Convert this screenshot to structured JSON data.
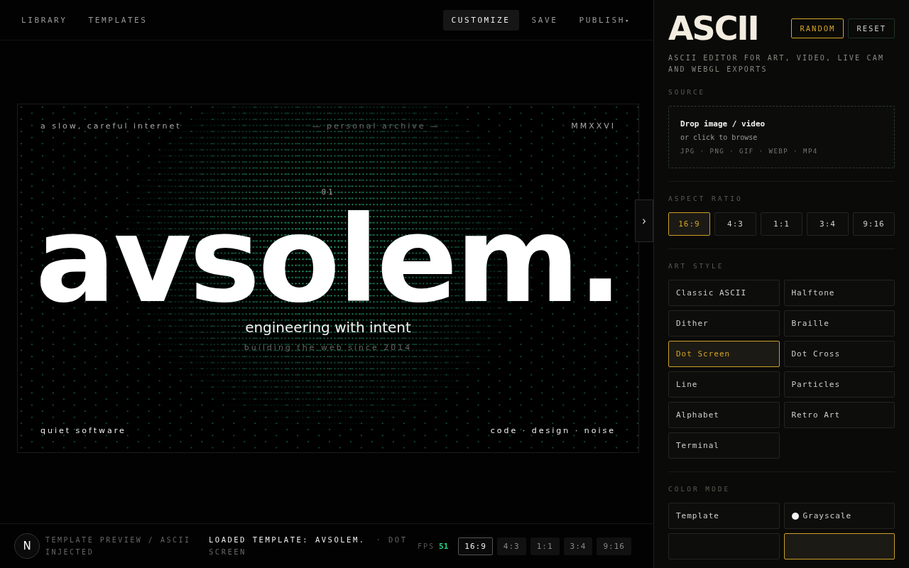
{
  "nav": {
    "left": [
      {
        "label": "LIBRARY",
        "selected": false
      },
      {
        "label": "TEMPLATES",
        "selected": false
      }
    ],
    "right": [
      {
        "label": "CUSTOMIZE",
        "selected": true,
        "kind": "tab"
      },
      {
        "label": "SAVE",
        "selected": false,
        "kind": "tab"
      },
      {
        "label": "PUBLISH",
        "selected": false,
        "kind": "menu",
        "caret": "▾"
      }
    ]
  },
  "preview": {
    "top_left": "a slow, careful internet",
    "top_center": "— personal archive —",
    "top_right": "MMXXVI",
    "index": "01",
    "headline": "avsolem.",
    "tagline": "engineering with intent",
    "subline": "building the web since 2014",
    "bottom_left": "quiet software",
    "bottom_right": "code · design · noise",
    "handle": "›"
  },
  "status_bar": {
    "badge": "N",
    "message": "TEMPLATE PREVIEW / ASCII INJECTED",
    "loaded": "LOADED TEMPLATE: AVSOLEM.",
    "style": "· DOT SCREEN",
    "fps_label": "FPS",
    "fps": "51",
    "ratios": [
      {
        "label": "16:9",
        "selected": true
      },
      {
        "label": "4:3",
        "selected": false
      },
      {
        "label": "1:1",
        "selected": false
      },
      {
        "label": "3:4",
        "selected": false
      },
      {
        "label": "9:16",
        "selected": false
      }
    ]
  },
  "panel": {
    "title": "ASCII",
    "buttons": [
      {
        "label": "RANDOM",
        "kind": "accent"
      },
      {
        "label": "RESET",
        "kind": "plain"
      }
    ],
    "subtitle": "ASCII EDITOR FOR ART, VIDEO, LIVE CAM AND WEBGL EXPORTS",
    "source": {
      "heading": "SOURCE",
      "title": "Drop image / video",
      "hint": "or click to browse",
      "formats": "JPG · PNG · GIF · WEBP · MP4"
    },
    "aspect": {
      "heading": "ASPECT RATIO",
      "options": [
        {
          "label": "16:9",
          "selected": true
        },
        {
          "label": "4:3",
          "selected": false
        },
        {
          "label": "1:1",
          "selected": false
        },
        {
          "label": "3:4",
          "selected": false
        },
        {
          "label": "9:16",
          "selected": false
        }
      ]
    },
    "art_style": {
      "heading": "ART STYLE",
      "options": [
        {
          "label": "Classic ASCII",
          "selected": false
        },
        {
          "label": "Halftone",
          "selected": false
        },
        {
          "label": "Dither",
          "selected": false
        },
        {
          "label": "Braille",
          "selected": false
        },
        {
          "label": "Dot Screen",
          "selected": true
        },
        {
          "label": "Dot Cross",
          "selected": false
        },
        {
          "label": "Line",
          "selected": false
        },
        {
          "label": "Particles",
          "selected": false
        },
        {
          "label": "Alphabet",
          "selected": false
        },
        {
          "label": "Retro Art",
          "selected": false
        },
        {
          "label": "Terminal",
          "selected": false
        }
      ]
    },
    "color_mode": {
      "heading": "COLOR MODE",
      "options": [
        {
          "label": "Template",
          "selected": false
        },
        {
          "label": "Grayscale",
          "selected": false,
          "color": "#f2f2f2"
        },
        {
          "selected": false
        },
        {
          "selected": true
        }
      ]
    }
  }
}
